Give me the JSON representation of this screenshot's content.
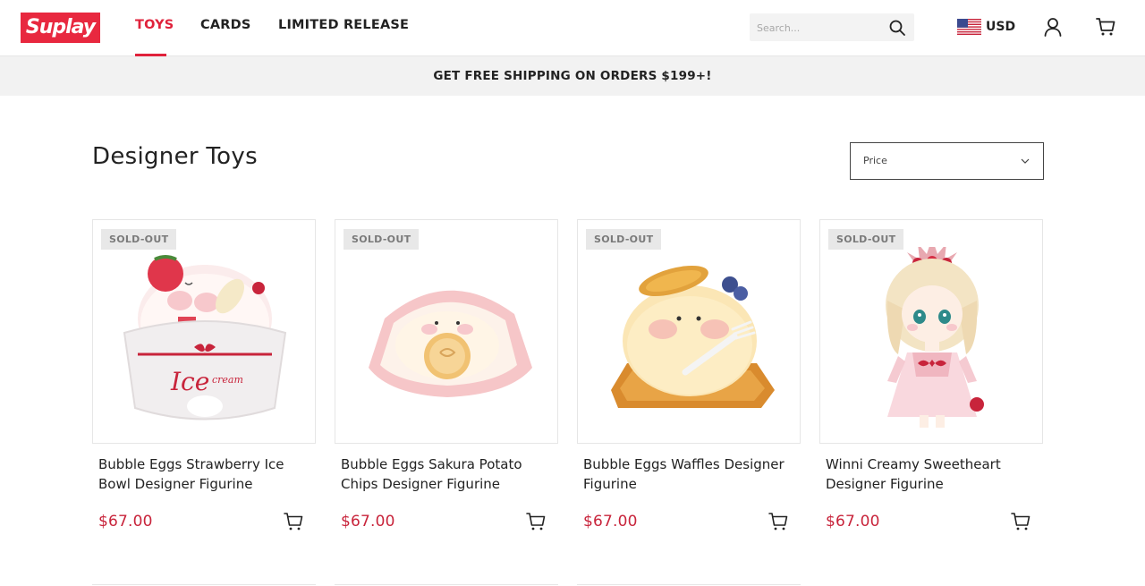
{
  "brand": {
    "logo_text": "Suplay",
    "color": "#e8283f"
  },
  "nav": [
    {
      "label": "TOYS",
      "active": true
    },
    {
      "label": "CARDS",
      "active": false
    },
    {
      "label": "LIMITED RELEASE",
      "active": false
    }
  ],
  "search": {
    "placeholder": "Search..."
  },
  "currency": {
    "label": "USD",
    "flag": "us-flag"
  },
  "banner": {
    "text": "GET FREE SHIPPING ON ORDERS $199+!"
  },
  "page": {
    "title": "Designer Toys"
  },
  "sort": {
    "selected": "Price"
  },
  "products": [
    {
      "badge": "SOLD-OUT",
      "name": "Bubble Eggs Strawberry Ice Bowl Designer Figurine",
      "price": "$67.00",
      "image": "strawberry-ice-bowl"
    },
    {
      "badge": "SOLD-OUT",
      "name": "Bubble Eggs Sakura Potato Chips Designer Figurine",
      "price": "$67.00",
      "image": "sakura-potato-chips"
    },
    {
      "badge": "SOLD-OUT",
      "name": "Bubble Eggs Waffles Designer Figurine",
      "price": "$67.00",
      "image": "waffles"
    },
    {
      "badge": "SOLD-OUT",
      "name": "Winni Creamy Sweetheart Designer Figurine",
      "price": "$67.00",
      "image": "winni-doll"
    }
  ],
  "colors": {
    "accent": "#e0223b",
    "price": "#c8243b",
    "banner_bg": "#f2f2f2",
    "badge_bg": "#e8e8e8"
  }
}
